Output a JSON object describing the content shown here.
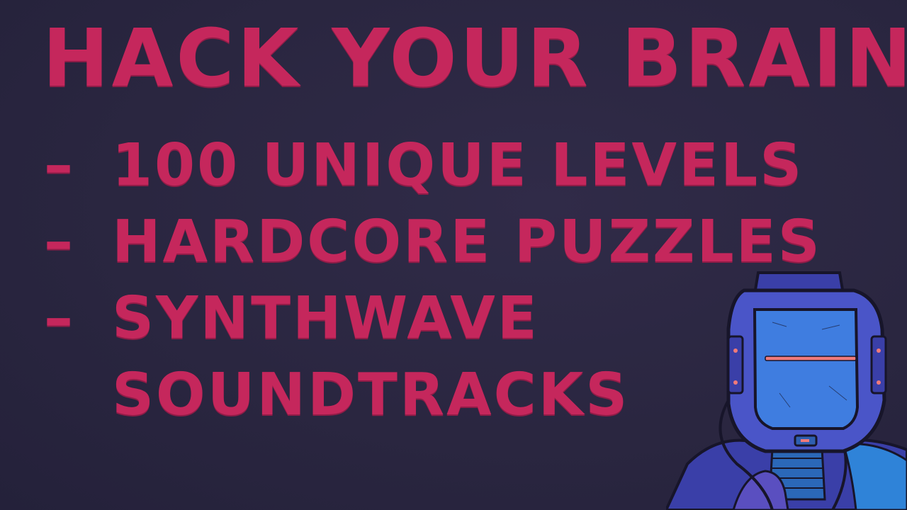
{
  "headline": "HACK YOUR BRAIN",
  "features": [
    {
      "bullet": "–",
      "lines": [
        "100 UNIQUE LEVELS"
      ]
    },
    {
      "bullet": "–",
      "lines": [
        "HARDCORE PUZZLES"
      ]
    },
    {
      "bullet": "–",
      "lines": [
        "SYNTHWAVE",
        "SOUNDTRACKS"
      ]
    }
  ],
  "colors": {
    "background": "#2a2640",
    "text": "#c5275c",
    "helmet": "#4a55c8",
    "visor": "#3f7de0",
    "visor_slit": "#f07a7a",
    "outline": "#17152a"
  },
  "character": {
    "icon": "robot-helmet-character-icon"
  }
}
